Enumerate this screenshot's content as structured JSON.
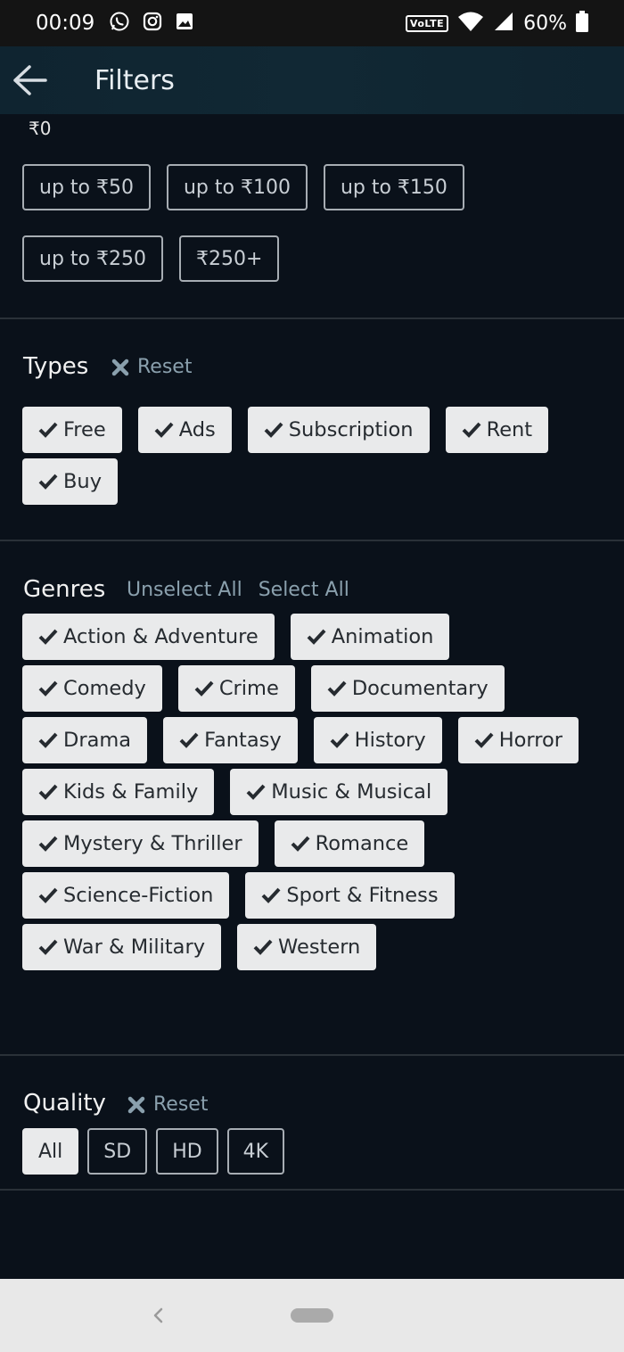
{
  "status_bar": {
    "time": "00:09",
    "network_label": "VoLTE",
    "battery_percent": "60%",
    "icons": [
      "whatsapp-icon",
      "instagram-icon",
      "gallery-icon",
      "wifi-icon",
      "signal-icon",
      "battery-icon"
    ]
  },
  "app_bar": {
    "title": "Filters",
    "back_icon": "arrow-left-icon"
  },
  "price": {
    "current": "₹0",
    "options": [
      "up to ₹50",
      "up to ₹100",
      "up to ₹150",
      "up to ₹250",
      "₹250+"
    ]
  },
  "types": {
    "title": "Types",
    "reset_label": "Reset",
    "items": [
      "Free",
      "Ads",
      "Subscription",
      "Rent",
      "Buy"
    ]
  },
  "genres": {
    "title": "Genres",
    "unselect_all": "Unselect All",
    "select_all": "Select All",
    "items": [
      "Action & Adventure",
      "Animation",
      "Comedy",
      "Crime",
      "Documentary",
      "Drama",
      "Fantasy",
      "History",
      "Horror",
      "Kids & Family",
      "Music & Musical",
      "Mystery & Thriller",
      "Romance",
      "Science-Fiction",
      "Sport & Fitness",
      "War & Military",
      "Western"
    ]
  },
  "quality": {
    "title": "Quality",
    "reset_label": "Reset",
    "options": [
      "All",
      "SD",
      "HD",
      "4K"
    ],
    "selected": "All"
  },
  "colors": {
    "background": "#0a111a",
    "chip_background": "#e9eaeb",
    "link_color": "#8aa0ad"
  }
}
